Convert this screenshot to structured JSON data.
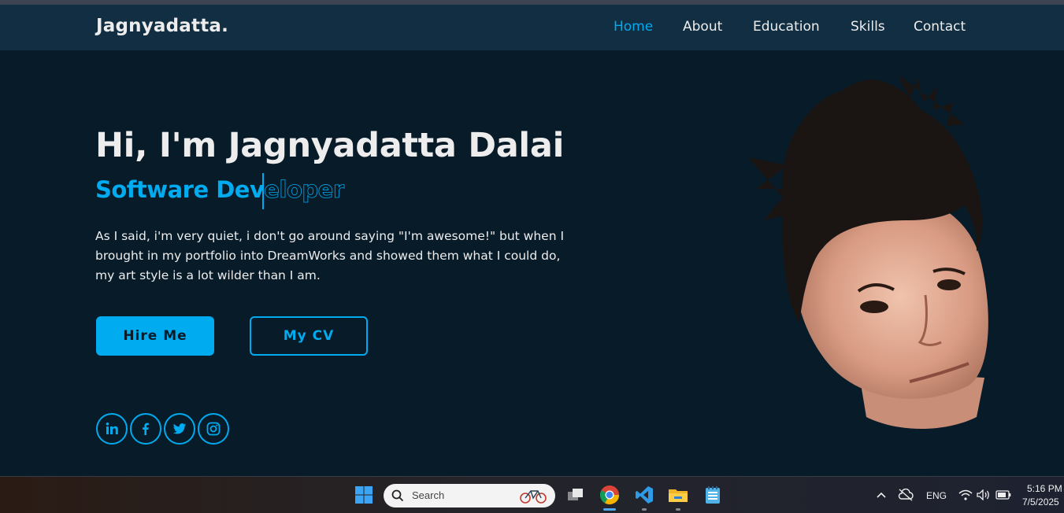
{
  "logo": "Jagnyadatta.",
  "nav": [
    {
      "label": "Home",
      "active": true
    },
    {
      "label": "About",
      "active": false
    },
    {
      "label": "Education",
      "active": false
    },
    {
      "label": "Skills",
      "active": false
    },
    {
      "label": "Contact",
      "active": false
    }
  ],
  "hero": {
    "title": "Hi, I'm Jagnyadatta Dalai",
    "subtitle_typed": "Software Dev",
    "subtitle_outline": "eloper",
    "paragraph": "As I said, i'm very quiet, i don't go around saying \"I'm awesome!\" but when I brought in my portfolio into DreamWorks and showed them what I could do, my art style is a lot wilder than I am.",
    "hire_button": "Hire Me",
    "cv_button": "My CV"
  },
  "social": [
    "linkedin-icon",
    "facebook-icon",
    "twitter-icon",
    "instagram-icon"
  ],
  "taskbar": {
    "search_placeholder": "Search",
    "language": "ENG",
    "time": "5:16 PM",
    "date": "7/5/2025"
  },
  "colors": {
    "accent": "#00abf0",
    "background": "#081b29",
    "navbar": "#112e42",
    "text": "#ededed"
  }
}
